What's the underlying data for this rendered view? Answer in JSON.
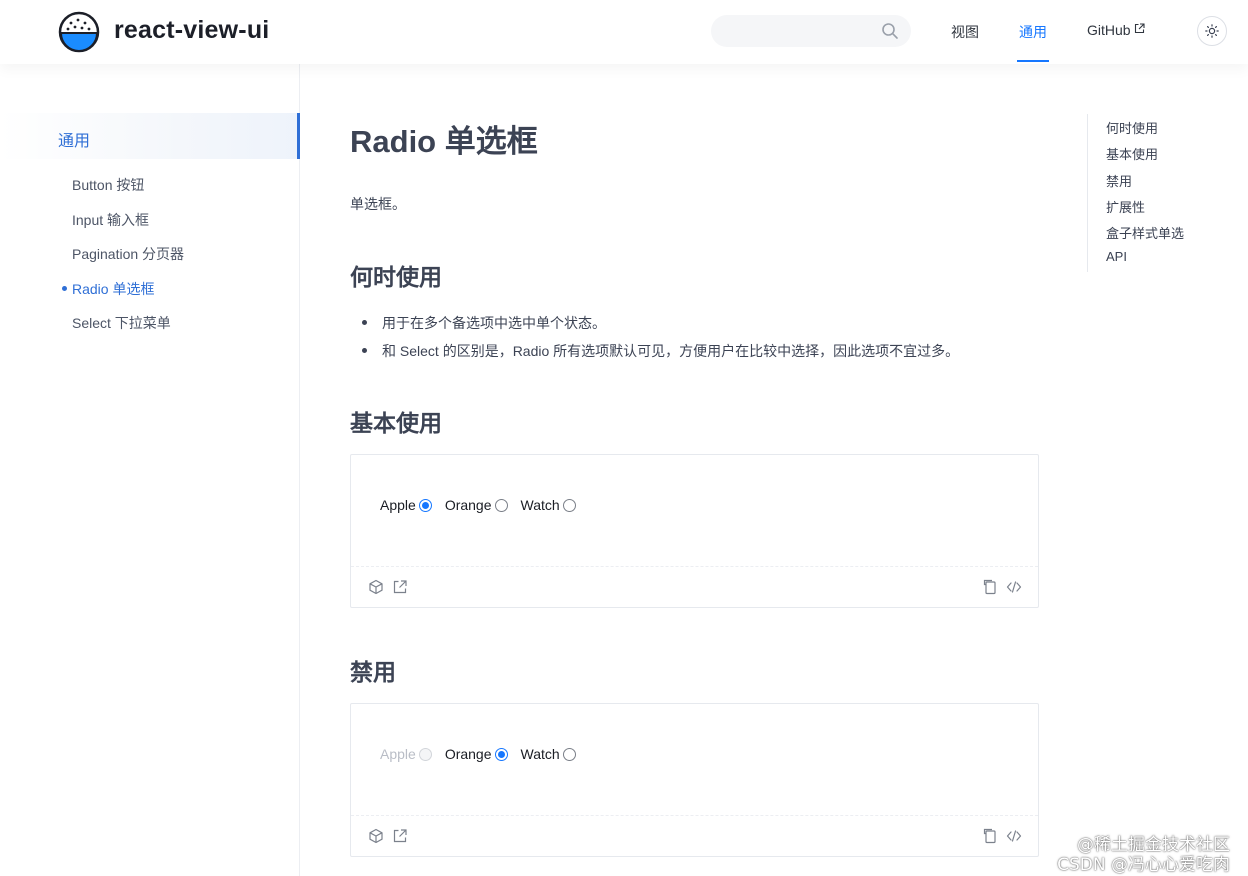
{
  "header": {
    "site_title": "react-view-ui",
    "search_placeholder": "",
    "nav": [
      {
        "label": "视图",
        "active": false
      },
      {
        "label": "通用",
        "active": true
      },
      {
        "label": "GitHub",
        "active": false
      }
    ],
    "accent_color": "#1677ff"
  },
  "sidebar": {
    "group_label": "通用",
    "items": [
      {
        "label": "Button 按钮",
        "active": false
      },
      {
        "label": "Input 输入框",
        "active": false
      },
      {
        "label": "Pagination 分页器",
        "active": false
      },
      {
        "label": "Radio 单选框",
        "active": true
      },
      {
        "label": "Select 下拉菜单",
        "active": false
      }
    ]
  },
  "main": {
    "title": "Radio 单选框",
    "intro": "单选框。",
    "sections": {
      "when": {
        "heading": "何时使用",
        "bullets": [
          "用于在多个备选项中选中单个状态。",
          "和 Select 的区别是，Radio 所有选项默认可见，方便用户在比较中选择，因此选项不宜过多。"
        ]
      },
      "basic": {
        "heading": "基本使用",
        "options": [
          {
            "label": "Apple",
            "checked": true,
            "disabled": false
          },
          {
            "label": "Orange",
            "checked": false,
            "disabled": false
          },
          {
            "label": "Watch",
            "checked": false,
            "disabled": false
          }
        ]
      },
      "disabled": {
        "heading": "禁用",
        "options": [
          {
            "label": "Apple",
            "checked": false,
            "disabled": true
          },
          {
            "label": "Orange",
            "checked": true,
            "disabled": false
          },
          {
            "label": "Watch",
            "checked": false,
            "disabled": false
          }
        ]
      }
    }
  },
  "toc": {
    "items": [
      "何时使用",
      "基本使用",
      "禁用",
      "扩展性",
      "盒子样式单选",
      "API"
    ]
  },
  "watermark": {
    "line1": "@稀土掘金技术社区",
    "line2": "CSDN @冯心心爱吃肉"
  }
}
